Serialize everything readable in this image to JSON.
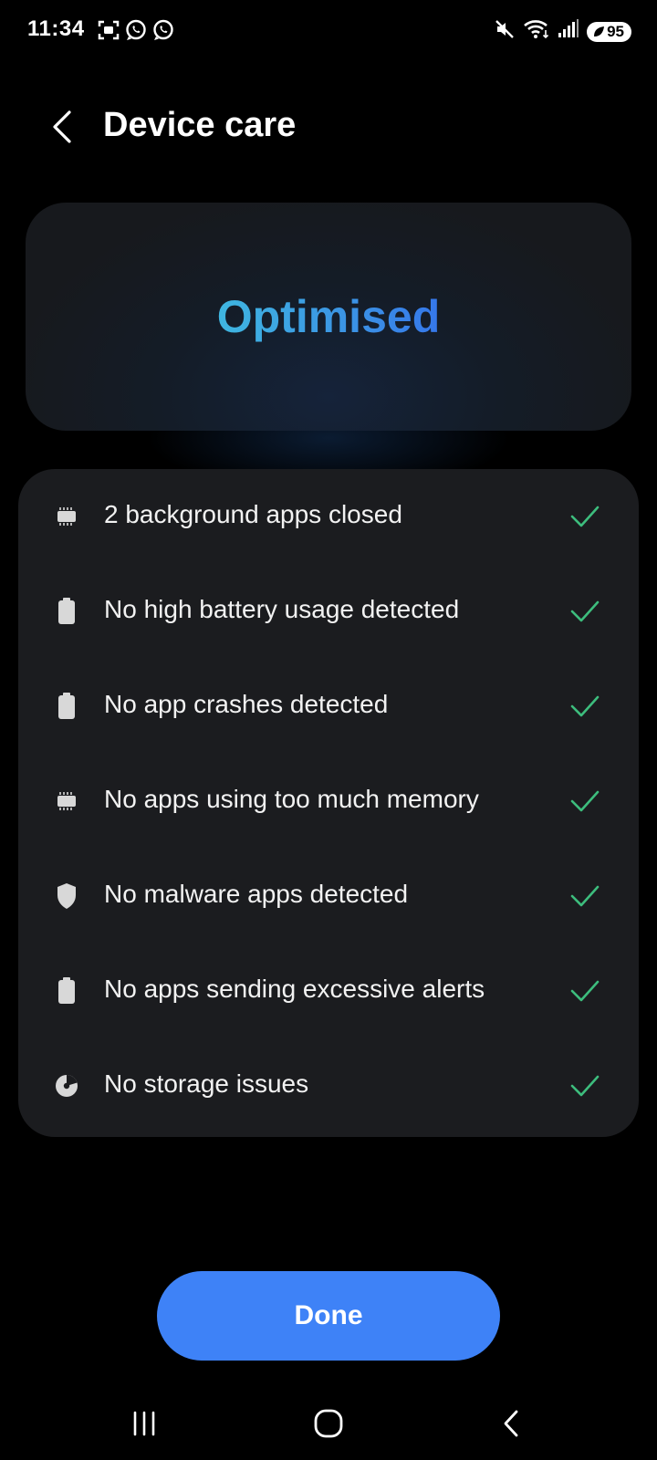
{
  "status_bar": {
    "time": "11:34",
    "left_icons": [
      "screenshot-icon",
      "whatsapp-icon",
      "whatsapp-icon"
    ],
    "right_icons": [
      "mute-icon",
      "wifi-icon",
      "signal-icon"
    ],
    "battery_level": "95"
  },
  "header": {
    "title": "Device care",
    "back_icon": "chevron-left-icon"
  },
  "status_card": {
    "headline": "Optimised"
  },
  "results": [
    {
      "icon": "memory-chip-icon",
      "label": "2 background apps closed",
      "status": "check-icon"
    },
    {
      "icon": "battery-icon",
      "label": "No high battery usage detected",
      "status": "check-icon"
    },
    {
      "icon": "battery-icon",
      "label": "No app crashes detected",
      "status": "check-icon"
    },
    {
      "icon": "memory-chip-icon",
      "label": "No apps using too much memory",
      "status": "check-icon"
    },
    {
      "icon": "shield-icon",
      "label": "No malware apps detected",
      "status": "check-icon"
    },
    {
      "icon": "battery-icon",
      "label": "No apps sending excessive alerts",
      "status": "check-icon"
    },
    {
      "icon": "storage-pie-icon",
      "label": "No storage issues",
      "status": "check-icon"
    }
  ],
  "footer": {
    "done_label": "Done"
  },
  "nav": {
    "recents_icon": "recents-icon",
    "home_icon": "home-icon",
    "back_icon": "back-icon"
  },
  "colors": {
    "background": "#000000",
    "card": "#1b1c1f",
    "accent": "#3e82f7",
    "check": "#3dbd7d",
    "headline_start": "#3fb6e0",
    "headline_end": "#3577ea"
  }
}
